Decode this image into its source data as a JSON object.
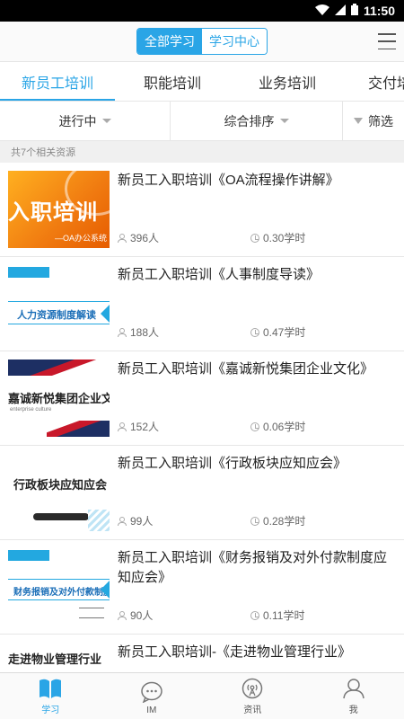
{
  "status_bar": {
    "time": "11:50"
  },
  "header": {
    "segments": [
      {
        "label": "全部学习",
        "active": true
      },
      {
        "label": "学习中心",
        "active": false
      }
    ]
  },
  "tabs": [
    {
      "label": "新员工培训",
      "active": true
    },
    {
      "label": "职能培训",
      "active": false
    },
    {
      "label": "业务培训",
      "active": false
    },
    {
      "label": "交付培",
      "active": false
    }
  ],
  "filters": {
    "status": "进行中",
    "sort": "综合排序",
    "filter": "筛选"
  },
  "result_count": "共7个相关资源",
  "thumbnails": {
    "t1_big": "入职培训",
    "t1_small": "—OA办公系统",
    "t2_text": "人力资源制度解读",
    "t3_text": "嘉诚新悦集团企业文化",
    "t3_sub": "enterprise culture",
    "t4_text": "行政板块应知应会",
    "t5_text": "财务报销及对外付款制度",
    "t6_text": "走进物业管理行业"
  },
  "courses": [
    {
      "title": "新员工入职培训《OA流程操作讲解》",
      "people": "396人",
      "hours": "0.30学时"
    },
    {
      "title": "新员工入职培训《人事制度导读》",
      "people": "188人",
      "hours": "0.47学时"
    },
    {
      "title": "新员工入职培训《嘉诚新悦集团企业文化》",
      "people": "152人",
      "hours": "0.06学时"
    },
    {
      "title": "新员工入职培训《行政板块应知应会》",
      "people": "99人",
      "hours": "0.28学时"
    },
    {
      "title": "新员工入职培训《财务报销及对外付款制度应知应会》",
      "people": "90人",
      "hours": "0.11学时"
    },
    {
      "title": "新员工入职培训-《走进物业管理行业》",
      "people": "",
      "hours": ""
    }
  ],
  "bottom_nav": [
    {
      "label": "学习",
      "icon": "book-icon",
      "active": true
    },
    {
      "label": "IM",
      "icon": "chat-icon",
      "active": false
    },
    {
      "label": "资讯",
      "icon": "broadcast-icon",
      "active": false
    },
    {
      "label": "我",
      "icon": "user-icon",
      "active": false
    }
  ],
  "colors": {
    "accent": "#2aa5e6"
  }
}
